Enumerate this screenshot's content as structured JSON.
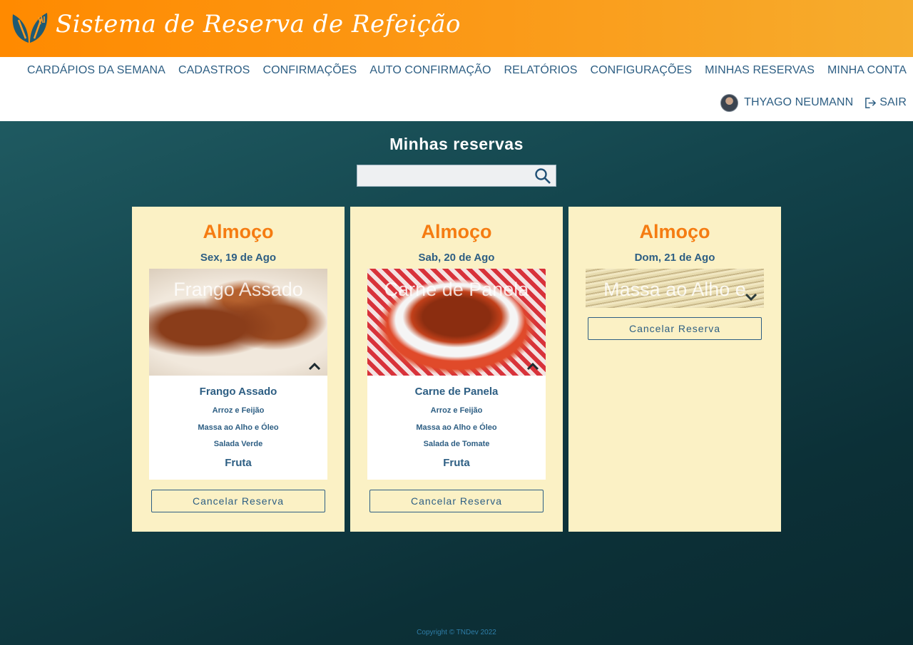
{
  "header": {
    "brand_title": "Sistema de Reserva de Refeição",
    "logo_icon": "leaf-utensils-icon",
    "colors": {
      "brand_orange": "#ff8a00",
      "brand_blue": "#2d5e83",
      "accent_orange": "#f57c12",
      "card_bg": "#fbf1c5"
    }
  },
  "nav": {
    "items": [
      {
        "label": "CARDÁPIOS DA SEMANA"
      },
      {
        "label": "CADASTROS"
      },
      {
        "label": "CONFIRMAÇÕES"
      },
      {
        "label": "AUTO CONFIRMAÇÃO"
      },
      {
        "label": "RELATÓRIOS"
      },
      {
        "label": "CONFIGURAÇÕES"
      },
      {
        "label": "MINHAS RESERVAS"
      },
      {
        "label": "MINHA CONTA"
      }
    ],
    "user_name": "THYAGO NEUMANN",
    "logout_label": "SAIR"
  },
  "main": {
    "title": "Minhas reservas",
    "search": {
      "placeholder": "",
      "value": ""
    }
  },
  "reservations": [
    {
      "meal": "Almoço",
      "date": "Sex, 19 de Ago",
      "photo_caption": "Frango Assado",
      "main_dish": "Frango Assado",
      "sides": [
        "Arroz e Feijão",
        "Massa ao Alho e Óleo",
        "Salada Verde"
      ],
      "dessert": "Fruta",
      "cancel_label": "Cancelar Reserva"
    },
    {
      "meal": "Almoço",
      "date": "Sab, 20 de Ago",
      "photo_caption": "Carne de Panela",
      "main_dish": "Carne de Panela",
      "sides": [
        "Arroz e Feijão",
        "Massa ao Alho e Óleo",
        "Salada de Tomate"
      ],
      "dessert": "Fruta",
      "cancel_label": "Cancelar Reserva"
    },
    {
      "meal": "Almoço",
      "date": "Dom, 21 de Ago",
      "photo_caption": "Massa ao Alho e",
      "cancel_label": "Cancelar Reserva"
    }
  ],
  "footer": {
    "copyright": "Copyright © TNDev 2022"
  }
}
